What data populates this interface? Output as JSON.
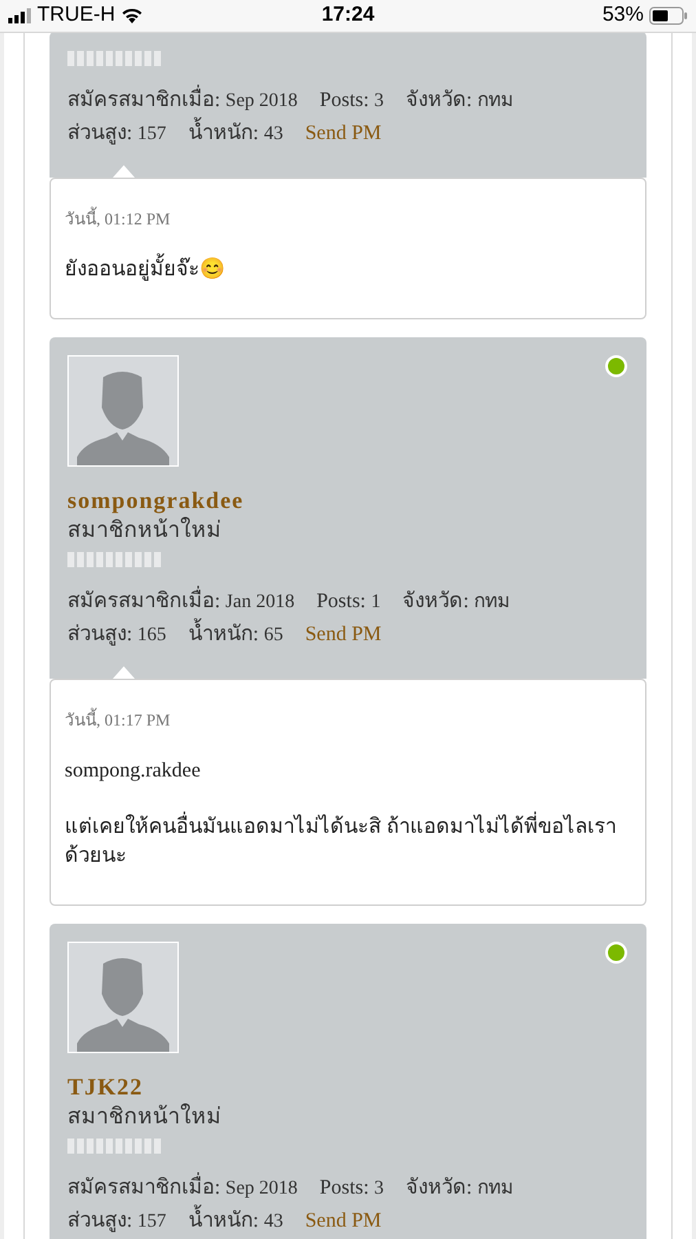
{
  "status_bar": {
    "carrier": "TRUE-H",
    "time": "17:24",
    "battery": "53%"
  },
  "posts": [
    {
      "stats": [
        [
          {
            "label": "สมัครสมาชิกเมื่อ:",
            "value": "Sep 2018"
          },
          {
            "label": "Posts:",
            "value": "3"
          },
          {
            "label": "จังหวัด:",
            "value": "กทม"
          }
        ],
        [
          {
            "label": "ส่วนสูง:",
            "value": "157"
          },
          {
            "label": "น้ำหนัก:",
            "value": "43"
          }
        ]
      ],
      "send_pm": "Send PM",
      "date": "วันนี้, 01:12 PM",
      "message": [
        "ยังออนอยู่มั้ยจ๊ะ😊"
      ]
    },
    {
      "user": {
        "name": "sompongrakdee",
        "rank": "สมาชิกหน้าใหม่",
        "online": true
      },
      "stats": [
        [
          {
            "label": "สมัครสมาชิกเมื่อ:",
            "value": "Jan 2018"
          },
          {
            "label": "Posts:",
            "value": "1"
          },
          {
            "label": "จังหวัด:",
            "value": "กทม"
          }
        ],
        [
          {
            "label": "ส่วนสูง:",
            "value": "165"
          },
          {
            "label": "น้ำหนัก:",
            "value": "65"
          }
        ]
      ],
      "send_pm": "Send PM",
      "date": "วันนี้, 01:17 PM",
      "message": [
        "sompong.rakdee",
        "แต่เคยให้คนอื่นมันแอดมาไม่ได้นะสิ ถ้าแอดมาไม่ได้พี่ขอไลเรา ด้วยนะ"
      ]
    },
    {
      "user": {
        "name": "TJK22",
        "rank": "สมาชิกหน้าใหม่",
        "online": true
      },
      "stats": [
        [
          {
            "label": "สมัครสมาชิกเมื่อ:",
            "value": "Sep 2018"
          },
          {
            "label": "Posts:",
            "value": "3"
          },
          {
            "label": "จังหวัด:",
            "value": "กทม"
          }
        ],
        [
          {
            "label": "ส่วนสูง:",
            "value": "157"
          },
          {
            "label": "น้ำหนัก:",
            "value": "43"
          }
        ]
      ],
      "send_pm": "Send PM"
    }
  ]
}
